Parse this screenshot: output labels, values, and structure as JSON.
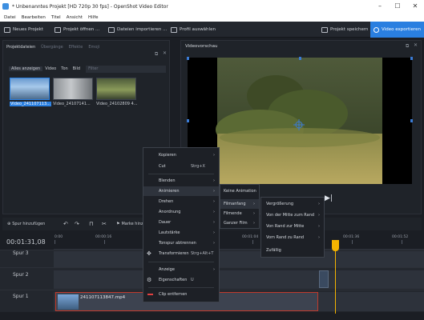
{
  "window": {
    "title": "* Unbenanntes Projekt [HD 720p 30 fps] - OpenShot Video Editor",
    "controls": {
      "minimize": "–",
      "maximize": "☐",
      "close": "✕"
    }
  },
  "menubar": [
    "Datei",
    "Bearbeiten",
    "Titel",
    "Ansicht",
    "Hilfe"
  ],
  "toolbar": {
    "new_project": "Neues Projekt",
    "open_project": "Projekt öffnen ...",
    "import_files": "Dateien importieren ...",
    "choose_profile": "Profil auswählen",
    "save_project": "Projekt speichern",
    "export_video": "Video exportieren"
  },
  "left_panel": {
    "tabs": [
      "Projektdateien",
      "Übergänge",
      "Effekte",
      "Emoji"
    ],
    "filters": [
      "Alles anzeigen",
      "Video",
      "Ton",
      "Bild"
    ],
    "filter_placeholder": "Filter",
    "files": [
      {
        "label": "Video_241107113...",
        "selected": true
      },
      {
        "label": "Video_24107141...",
        "selected": false
      },
      {
        "label": "Video_24102809 4...",
        "selected": false
      }
    ]
  },
  "preview": {
    "title": "Videovorschau"
  },
  "timeline_toolbar": {
    "add_track": "Spur hinzufügen",
    "add_marker": "Marke hinzu..."
  },
  "timeline": {
    "timecode": "00:01:31,08",
    "ticks": [
      "0:00",
      "00:00:16",
      "00:01:04",
      "00:01:20",
      "00:01:36",
      "00:01:52"
    ],
    "tracks": [
      {
        "label": "Spur 3"
      },
      {
        "label": "Spur 2"
      },
      {
        "label": "Spur 1",
        "clip": "241107113847.mp4"
      }
    ]
  },
  "context_menu": {
    "items": [
      {
        "label": "Kopieren",
        "shortcut": "",
        "submenu": true
      },
      {
        "label": "Cut",
        "shortcut": "Strg+X",
        "submenu": false
      },
      {
        "label": "Blenden",
        "shortcut": "",
        "submenu": true
      },
      {
        "label": "Animieren",
        "shortcut": "",
        "submenu": true
      },
      {
        "label": "Drehen",
        "shortcut": "",
        "submenu": true
      },
      {
        "label": "Anordnung",
        "shortcut": "",
        "submenu": true
      },
      {
        "label": "Dauer",
        "shortcut": "",
        "submenu": true
      },
      {
        "label": "Lautstärke",
        "shortcut": "",
        "submenu": true
      },
      {
        "label": "Tonspur abtrennen",
        "shortcut": "",
        "submenu": true
      },
      {
        "label": "Transformieren",
        "shortcut": "Strg+Alt+T",
        "submenu": false
      },
      {
        "label": "Anzeige",
        "shortcut": "",
        "submenu": true
      },
      {
        "label": "Eigenschaften",
        "shortcut": "U",
        "submenu": false
      },
      {
        "label": "Clip entfernen",
        "shortcut": "",
        "submenu": false
      }
    ]
  },
  "animate_submenu": {
    "items": [
      "Keine Animation",
      "Filmanfang",
      "Filmende",
      "Ganzer Film"
    ]
  },
  "start_submenu": {
    "items": [
      "Vergrößerung",
      "Von der Mitte zum Rand",
      "Von Rand zur Mitte",
      "Vom Rand zu Rand",
      "Zufällig"
    ]
  },
  "colors": {
    "accent": "#2a7fe0",
    "playhead": "#f5b400",
    "clip_border": "#c0392b"
  }
}
